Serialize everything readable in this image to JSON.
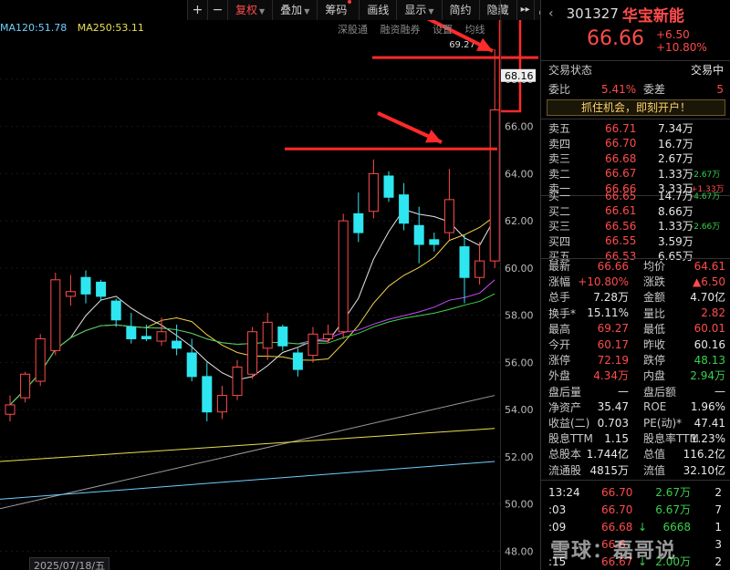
{
  "toolbar": {
    "plus": "+",
    "minus": "−",
    "restore": "复权",
    "overlay": "叠加",
    "chips": "筹码",
    "draw": "画线",
    "display": "显示",
    "simple": "简约",
    "hide": "隐藏",
    "more": "▸▸",
    "expand": "⤢"
  },
  "ma_labels": {
    "ma120": "MA120:51.78",
    "ma250": "MA250:53.11"
  },
  "sub_links": {
    "sh": "深股通",
    "margin": "融资融券",
    "settings": "设置",
    "lines": "均线"
  },
  "chart_annot": {
    "high_label": "69.27",
    "last_price_tag": "68.16"
  },
  "date_label": "2025/07/18/五",
  "chart_data": {
    "type": "candlestick",
    "price_ticks": [
      "68.00",
      "66.00",
      "64.00",
      "62.00",
      "60.00",
      "58.00",
      "56.00",
      "54.00",
      "52.00",
      "50.00",
      "48.00"
    ],
    "ylim": [
      47.2,
      70.2
    ],
    "candles": [
      {
        "o": 53.8,
        "h": 54.6,
        "l": 53.5,
        "c": 54.2
      },
      {
        "o": 54.5,
        "h": 55.6,
        "l": 54.3,
        "c": 55.5
      },
      {
        "o": 55.2,
        "h": 57.2,
        "l": 55.0,
        "c": 57.0
      },
      {
        "o": 56.5,
        "h": 59.8,
        "l": 56.3,
        "c": 59.5
      },
      {
        "o": 58.8,
        "h": 59.7,
        "l": 58.4,
        "c": 59.0
      },
      {
        "o": 59.6,
        "h": 59.9,
        "l": 58.5,
        "c": 58.9
      },
      {
        "o": 59.4,
        "h": 59.5,
        "l": 58.6,
        "c": 58.8
      },
      {
        "o": 58.6,
        "h": 58.7,
        "l": 57.5,
        "c": 57.8
      },
      {
        "o": 57.5,
        "h": 58.1,
        "l": 56.8,
        "c": 57.0
      },
      {
        "o": 57.1,
        "h": 57.6,
        "l": 56.9,
        "c": 57.0
      },
      {
        "o": 56.9,
        "h": 57.9,
        "l": 56.7,
        "c": 57.3
      },
      {
        "o": 56.9,
        "h": 57.6,
        "l": 56.3,
        "c": 56.6
      },
      {
        "o": 56.4,
        "h": 57.0,
        "l": 55.2,
        "c": 55.4
      },
      {
        "o": 55.4,
        "h": 56.0,
        "l": 53.5,
        "c": 53.9
      },
      {
        "o": 53.9,
        "h": 55.0,
        "l": 53.6,
        "c": 54.6
      },
      {
        "o": 54.6,
        "h": 56.1,
        "l": 54.4,
        "c": 55.8
      },
      {
        "o": 55.5,
        "h": 57.5,
        "l": 55.3,
        "c": 57.3
      },
      {
        "o": 56.6,
        "h": 58.1,
        "l": 56.1,
        "c": 57.7
      },
      {
        "o": 57.5,
        "h": 57.6,
        "l": 56.5,
        "c": 56.7
      },
      {
        "o": 56.4,
        "h": 56.6,
        "l": 55.4,
        "c": 55.7
      },
      {
        "o": 56.3,
        "h": 57.5,
        "l": 56.0,
        "c": 57.2
      },
      {
        "o": 57.0,
        "h": 57.6,
        "l": 56.8,
        "c": 57.2
      },
      {
        "o": 57.3,
        "h": 62.3,
        "l": 57.0,
        "c": 62.0
      },
      {
        "o": 62.3,
        "h": 63.2,
        "l": 61.1,
        "c": 61.5
      },
      {
        "o": 62.4,
        "h": 64.6,
        "l": 62.1,
        "c": 64.0
      },
      {
        "o": 63.9,
        "h": 64.1,
        "l": 62.8,
        "c": 63.0
      },
      {
        "o": 63.1,
        "h": 63.6,
        "l": 61.6,
        "c": 61.9
      },
      {
        "o": 61.8,
        "h": 62.6,
        "l": 60.2,
        "c": 61.0
      },
      {
        "o": 61.2,
        "h": 61.5,
        "l": 60.7,
        "c": 61.0
      },
      {
        "o": 61.5,
        "h": 64.2,
        "l": 61.2,
        "c": 62.9
      },
      {
        "o": 60.9,
        "h": 61.4,
        "l": 58.5,
        "c": 59.6
      },
      {
        "o": 59.6,
        "h": 61.1,
        "l": 59.3,
        "c": 60.3
      },
      {
        "o": 60.3,
        "h": 69.27,
        "l": 60.0,
        "c": 66.7
      }
    ]
  },
  "panel": {
    "code": "301327",
    "name": "华宝新能",
    "price": "66.66",
    "change": "+6.50",
    "change_pct": "+10.80%",
    "status_label": "交易状态",
    "status_value": "交易中",
    "weibi_label": "委比",
    "weibi_value": "5.41%",
    "weicha_label": "委差",
    "weicha_value": "5",
    "promo": "抓住机会，即刻开户！",
    "asks": [
      {
        "label": "卖五",
        "price": "66.71",
        "vol": "7.34万",
        "delta": ""
      },
      {
        "label": "卖四",
        "price": "66.70",
        "vol": "16.7万",
        "delta": ""
      },
      {
        "label": "卖三",
        "price": "66.68",
        "vol": "2.67万",
        "delta": ""
      },
      {
        "label": "卖二",
        "price": "66.67",
        "vol": "1.33万",
        "delta": "-2.67万"
      },
      {
        "label": "卖一",
        "price": "66.66",
        "vol": "3.33万",
        "delta": "+1.33万"
      }
    ],
    "bids": [
      {
        "label": "买一",
        "price": "66.65",
        "vol": "14.7万",
        "delta": "-4.67万"
      },
      {
        "label": "买二",
        "price": "66.61",
        "vol": "8.66万",
        "delta": ""
      },
      {
        "label": "买三",
        "price": "66.56",
        "vol": "1.33万",
        "delta": "-2.66万"
      },
      {
        "label": "买四",
        "price": "66.55",
        "vol": "3.59万",
        "delta": ""
      },
      {
        "label": "买五",
        "price": "66.53",
        "vol": "6.65万",
        "delta": ""
      }
    ],
    "stats": [
      {
        "l1": "最新",
        "v1": "66.66",
        "c1": "red",
        "l2": "均价",
        "v2": "64.61",
        "c2": "red"
      },
      {
        "l1": "涨幅",
        "v1": "+10.80%",
        "c1": "red",
        "l2": "涨跌",
        "v2": "▲6.50",
        "c2": "red"
      },
      {
        "l1": "总手",
        "v1": "7.28万",
        "c1": "white",
        "l2": "金额",
        "v2": "4.70亿",
        "c2": "white"
      },
      {
        "l1": "换手*",
        "v1": "15.11%",
        "c1": "white",
        "l2": "量比",
        "v2": "2.82",
        "c2": "red"
      },
      {
        "l1": "最高",
        "v1": "69.27",
        "c1": "red",
        "l2": "最低",
        "v2": "60.01",
        "c2": "red"
      },
      {
        "l1": "今开",
        "v1": "60.17",
        "c1": "red",
        "l2": "昨收",
        "v2": "60.16",
        "c2": "white"
      },
      {
        "l1": "涨停",
        "v1": "72.19",
        "c1": "red",
        "l2": "跌停",
        "v2": "48.13",
        "c2": "green"
      },
      {
        "l1": "外盘",
        "v1": "4.34万",
        "c1": "red",
        "l2": "内盘",
        "v2": "2.94万",
        "c2": "green"
      },
      {
        "l1": "盘后量",
        "v1": "—",
        "c1": "white",
        "l2": "盘后额",
        "v2": "—",
        "c2": "white"
      },
      {
        "l1": "净资产",
        "v1": "35.47",
        "c1": "white",
        "l2": "ROE",
        "v2": "1.96%",
        "c2": "white"
      },
      {
        "l1": "收益(二)",
        "v1": "0.703",
        "c1": "white",
        "l2": "PE(动)*",
        "v2": "47.41",
        "c2": "white"
      },
      {
        "l1": "股息TTM",
        "v1": "1.15",
        "c1": "white",
        "l2": "股息率TTM",
        "v2": "1.23%",
        "c2": "white"
      },
      {
        "l1": "总股本",
        "v1": "1.744亿",
        "c1": "white",
        "l2": "总值",
        "v2": "116.2亿",
        "c2": "white"
      },
      {
        "l1": "流通股",
        "v1": "4815万",
        "c1": "white",
        "l2": "流值",
        "v2": "32.10亿",
        "c2": "white"
      }
    ],
    "ticks": [
      {
        "t": "13:24",
        "p": "66.70",
        "v": "2.67万",
        "n": "2",
        "arrow": ""
      },
      {
        "t": ":03",
        "p": "66.70",
        "v": "6.67万",
        "n": "7",
        "arrow": ""
      },
      {
        "t": ":09",
        "p": "66.68",
        "v": "6668",
        "n": "1",
        "arrow": "↓"
      },
      {
        "t": "",
        "p": "66.6",
        "v": "",
        "n": "3",
        "arrow": ""
      },
      {
        "t": ":15",
        "p": "66.67",
        "v": "2.00万",
        "n": "2",
        "arrow": "↓"
      }
    ],
    "watermark": "雪球：磊哥说"
  },
  "colors": {
    "up": "#ff4b4b",
    "down": "#2ee6f0",
    "bg": "#000000"
  }
}
